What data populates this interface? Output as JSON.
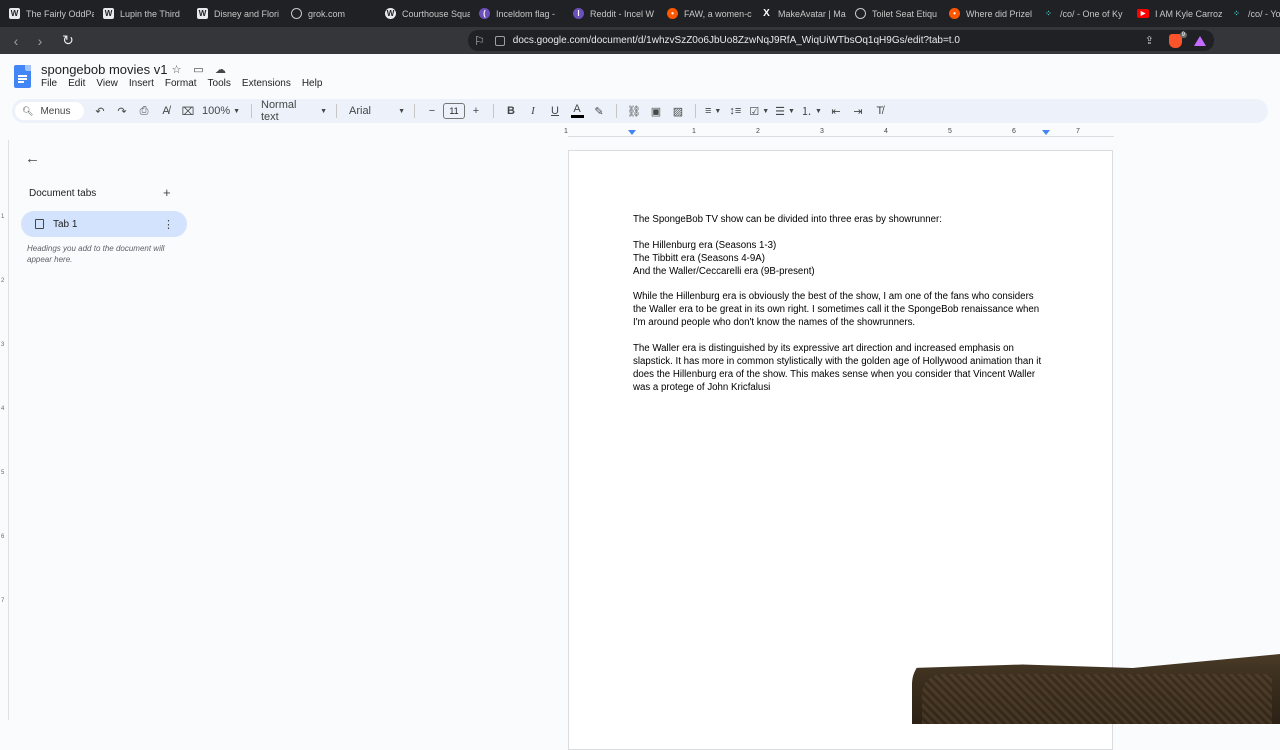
{
  "browser_tabs": [
    {
      "label": "The Fairly OddPa",
      "icon": "wikipedia-icon"
    },
    {
      "label": "Lupin the Third",
      "icon": "wikipedia-icon"
    },
    {
      "label": "Disney and Flori",
      "icon": "wikipedia-icon"
    },
    {
      "label": "grok.com",
      "icon": "grok-icon"
    },
    {
      "label": "Courthouse Squa",
      "icon": "wordpress-icon"
    },
    {
      "label": "Inceldom flag - ",
      "icon": "site-icon"
    },
    {
      "label": "Reddit - Incel W",
      "icon": "site-icon"
    },
    {
      "label": "FAW, a women-c",
      "icon": "reddit-icon"
    },
    {
      "label": "MakeAvatar | Ma",
      "icon": "x-icon"
    },
    {
      "label": "Toilet Seat Etiqu",
      "icon": "site-icon"
    },
    {
      "label": "Where did Prizel",
      "icon": "reddit-icon"
    },
    {
      "label": "/co/ - One of Ky",
      "icon": "4chan-icon"
    },
    {
      "label": "I AM Kyle Carroz",
      "icon": "youtube-icon"
    },
    {
      "label": "/co/ - You have",
      "icon": "4chan-icon"
    }
  ],
  "address_bar": {
    "url": "docs.google.com/document/d/1whzvSzZ0o6JbUo8ZzwNqJ9RfA_WiqUiWTbsOq1qH9Gs/edit?tab=t.0",
    "brave_badge": "9"
  },
  "doc": {
    "title": "spongebob movies v1",
    "menu": [
      "File",
      "Edit",
      "View",
      "Insert",
      "Format",
      "Tools",
      "Extensions",
      "Help"
    ]
  },
  "toolbar": {
    "menus_placeholder": "Menus",
    "zoom": "100%",
    "style": "Normal text",
    "font": "Arial",
    "font_size": "11"
  },
  "ruler": {
    "numbers": [
      "1",
      "1",
      "2",
      "3",
      "4",
      "5",
      "6",
      "7"
    ]
  },
  "vruler": {
    "numbers": [
      "1",
      "2",
      "3",
      "4",
      "5",
      "6",
      "7"
    ]
  },
  "sidebar": {
    "section_label": "Document tabs",
    "tab_label": "Tab 1",
    "hint": "Headings you add to the document will appear here."
  },
  "content": {
    "intro": "The SpongeBob TV show can be divided into three eras by showrunner:",
    "eras": [
      "The Hillenburg era (Seasons 1-3)",
      "The Tibbitt era (Seasons 4-9A)",
      "And the Waller/Ceccarelli era (9B-present)"
    ],
    "para1_lines": [
      "While the Hillenburg era is obviously the best of the show, I am one of the fans who considers",
      "the Waller era to be great in its own right. I sometimes call it the SpongeBob renaissance when",
      "I'm around people who don't know the names of the showrunners."
    ],
    "para2_lines": [
      "The Waller era is distinguished by its expressive art direction and increased emphasis on",
      "slapstick. It has more in common stylistically with the golden age of Hollywood animation than it",
      "does the Hillenburg era of the show. This makes sense when you consider that Vincent Waller",
      "was a protege of John Kricfalusi"
    ]
  }
}
